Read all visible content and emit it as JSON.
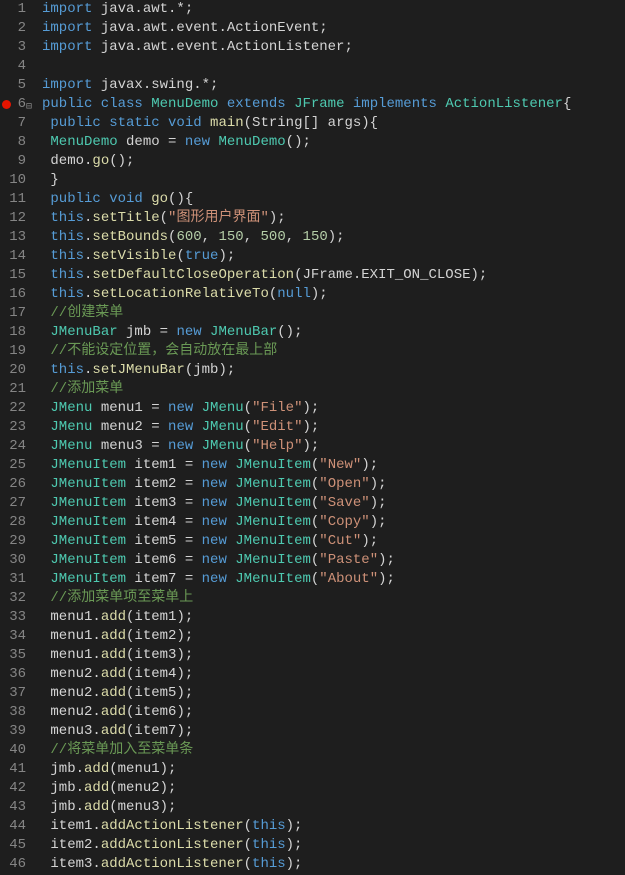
{
  "lines": [
    {
      "num": 1,
      "tokens": [
        [
          "kw",
          "import"
        ],
        [
          "punct",
          " java.awt.*;"
        ]
      ]
    },
    {
      "num": 2,
      "tokens": [
        [
          "kw",
          "import"
        ],
        [
          "punct",
          " java.awt.event.ActionEvent;"
        ]
      ]
    },
    {
      "num": 3,
      "tokens": [
        [
          "kw",
          "import"
        ],
        [
          "punct",
          " java.awt.event.ActionListener;"
        ]
      ]
    },
    {
      "num": 4,
      "tokens": [
        [
          "punct",
          ""
        ]
      ]
    },
    {
      "num": 5,
      "tokens": [
        [
          "kw",
          "import"
        ],
        [
          "punct",
          " javax.swing.*;"
        ]
      ]
    },
    {
      "num": 6,
      "breakpoint": true,
      "fold": true,
      "tokens": [
        [
          "kw",
          "public class "
        ],
        [
          "type",
          "MenuDemo"
        ],
        [
          "kw",
          " extends "
        ],
        [
          "type",
          "JFrame"
        ],
        [
          "kw",
          " implements "
        ],
        [
          "type",
          "ActionListener"
        ],
        [
          "punct",
          "{"
        ]
      ]
    },
    {
      "num": 7,
      "tokens": [
        [
          "punct",
          " "
        ],
        [
          "kw",
          "public static void "
        ],
        [
          "fn",
          "main"
        ],
        [
          "punct",
          "(String[] args){"
        ]
      ]
    },
    {
      "num": 8,
      "tokens": [
        [
          "punct",
          " "
        ],
        [
          "type",
          "MenuDemo"
        ],
        [
          "punct",
          " demo = "
        ],
        [
          "kw",
          "new "
        ],
        [
          "type",
          "MenuDemo"
        ],
        [
          "punct",
          "();"
        ]
      ]
    },
    {
      "num": 9,
      "tokens": [
        [
          "punct",
          " demo."
        ],
        [
          "fn",
          "go"
        ],
        [
          "punct",
          "();"
        ]
      ]
    },
    {
      "num": 10,
      "tokens": [
        [
          "punct",
          " }"
        ]
      ]
    },
    {
      "num": 11,
      "tokens": [
        [
          "punct",
          " "
        ],
        [
          "kw",
          "public void "
        ],
        [
          "fn",
          "go"
        ],
        [
          "punct",
          "(){"
        ]
      ]
    },
    {
      "num": 12,
      "tokens": [
        [
          "punct",
          " "
        ],
        [
          "kw",
          "this"
        ],
        [
          "punct",
          "."
        ],
        [
          "fn",
          "setTitle"
        ],
        [
          "punct",
          "("
        ],
        [
          "str",
          "\"图形用户界面\""
        ],
        [
          "punct",
          ");"
        ]
      ]
    },
    {
      "num": 13,
      "tokens": [
        [
          "punct",
          " "
        ],
        [
          "kw",
          "this"
        ],
        [
          "punct",
          "."
        ],
        [
          "fn",
          "setBounds"
        ],
        [
          "punct",
          "("
        ],
        [
          "num",
          "600"
        ],
        [
          "punct",
          ", "
        ],
        [
          "num",
          "150"
        ],
        [
          "punct",
          ", "
        ],
        [
          "num",
          "500"
        ],
        [
          "punct",
          ", "
        ],
        [
          "num",
          "150"
        ],
        [
          "punct",
          ");"
        ]
      ]
    },
    {
      "num": 14,
      "tokens": [
        [
          "punct",
          " "
        ],
        [
          "kw",
          "this"
        ],
        [
          "punct",
          "."
        ],
        [
          "fn",
          "setVisible"
        ],
        [
          "punct",
          "("
        ],
        [
          "kw",
          "true"
        ],
        [
          "punct",
          ");"
        ]
      ]
    },
    {
      "num": 15,
      "tokens": [
        [
          "punct",
          " "
        ],
        [
          "kw",
          "this"
        ],
        [
          "punct",
          "."
        ],
        [
          "fn",
          "setDefaultCloseOperation"
        ],
        [
          "punct",
          "(JFrame.EXIT_ON_CLOSE);"
        ]
      ]
    },
    {
      "num": 16,
      "tokens": [
        [
          "punct",
          " "
        ],
        [
          "kw",
          "this"
        ],
        [
          "punct",
          "."
        ],
        [
          "fn",
          "setLocationRelativeTo"
        ],
        [
          "punct",
          "("
        ],
        [
          "kw",
          "null"
        ],
        [
          "punct",
          ");"
        ]
      ]
    },
    {
      "num": 17,
      "tokens": [
        [
          "punct",
          " "
        ],
        [
          "cmt",
          "//创建菜单"
        ]
      ]
    },
    {
      "num": 18,
      "tokens": [
        [
          "punct",
          " "
        ],
        [
          "type",
          "JMenuBar"
        ],
        [
          "punct",
          " jmb = "
        ],
        [
          "kw",
          "new "
        ],
        [
          "type",
          "JMenuBar"
        ],
        [
          "punct",
          "();"
        ]
      ]
    },
    {
      "num": 19,
      "tokens": [
        [
          "punct",
          " "
        ],
        [
          "cmt",
          "//不能设定位置，会自动放在最上部"
        ]
      ]
    },
    {
      "num": 20,
      "tokens": [
        [
          "punct",
          " "
        ],
        [
          "kw",
          "this"
        ],
        [
          "punct",
          "."
        ],
        [
          "fn",
          "setJMenuBar"
        ],
        [
          "punct",
          "(jmb);"
        ]
      ]
    },
    {
      "num": 21,
      "tokens": [
        [
          "punct",
          " "
        ],
        [
          "cmt",
          "//添加菜单"
        ]
      ]
    },
    {
      "num": 22,
      "tokens": [
        [
          "punct",
          " "
        ],
        [
          "type",
          "JMenu"
        ],
        [
          "punct",
          " menu1 = "
        ],
        [
          "kw",
          "new "
        ],
        [
          "type",
          "JMenu"
        ],
        [
          "punct",
          "("
        ],
        [
          "str",
          "\"File\""
        ],
        [
          "punct",
          ");"
        ]
      ]
    },
    {
      "num": 23,
      "tokens": [
        [
          "punct",
          " "
        ],
        [
          "type",
          "JMenu"
        ],
        [
          "punct",
          " menu2 = "
        ],
        [
          "kw",
          "new "
        ],
        [
          "type",
          "JMenu"
        ],
        [
          "punct",
          "("
        ],
        [
          "str",
          "\"Edit\""
        ],
        [
          "punct",
          ");"
        ]
      ]
    },
    {
      "num": 24,
      "tokens": [
        [
          "punct",
          " "
        ],
        [
          "type",
          "JMenu"
        ],
        [
          "punct",
          " menu3 = "
        ],
        [
          "kw",
          "new "
        ],
        [
          "type",
          "JMenu"
        ],
        [
          "punct",
          "("
        ],
        [
          "str",
          "\"Help\""
        ],
        [
          "punct",
          ");"
        ]
      ]
    },
    {
      "num": 25,
      "tokens": [
        [
          "punct",
          " "
        ],
        [
          "type",
          "JMenuItem"
        ],
        [
          "punct",
          " item1 = "
        ],
        [
          "kw",
          "new "
        ],
        [
          "type",
          "JMenuItem"
        ],
        [
          "punct",
          "("
        ],
        [
          "str",
          "\"New\""
        ],
        [
          "punct",
          ");"
        ]
      ]
    },
    {
      "num": 26,
      "tokens": [
        [
          "punct",
          " "
        ],
        [
          "type",
          "JMenuItem"
        ],
        [
          "punct",
          " item2 = "
        ],
        [
          "kw",
          "new "
        ],
        [
          "type",
          "JMenuItem"
        ],
        [
          "punct",
          "("
        ],
        [
          "str",
          "\"Open\""
        ],
        [
          "punct",
          ");"
        ]
      ]
    },
    {
      "num": 27,
      "tokens": [
        [
          "punct",
          " "
        ],
        [
          "type",
          "JMenuItem"
        ],
        [
          "punct",
          " item3 = "
        ],
        [
          "kw",
          "new "
        ],
        [
          "type",
          "JMenuItem"
        ],
        [
          "punct",
          "("
        ],
        [
          "str",
          "\"Save\""
        ],
        [
          "punct",
          ");"
        ]
      ]
    },
    {
      "num": 28,
      "tokens": [
        [
          "punct",
          " "
        ],
        [
          "type",
          "JMenuItem"
        ],
        [
          "punct",
          " item4 = "
        ],
        [
          "kw",
          "new "
        ],
        [
          "type",
          "JMenuItem"
        ],
        [
          "punct",
          "("
        ],
        [
          "str",
          "\"Copy\""
        ],
        [
          "punct",
          ");"
        ]
      ]
    },
    {
      "num": 29,
      "tokens": [
        [
          "punct",
          " "
        ],
        [
          "type",
          "JMenuItem"
        ],
        [
          "punct",
          " item5 = "
        ],
        [
          "kw",
          "new "
        ],
        [
          "type",
          "JMenuItem"
        ],
        [
          "punct",
          "("
        ],
        [
          "str",
          "\"Cut\""
        ],
        [
          "punct",
          ");"
        ]
      ]
    },
    {
      "num": 30,
      "tokens": [
        [
          "punct",
          " "
        ],
        [
          "type",
          "JMenuItem"
        ],
        [
          "punct",
          " item6 = "
        ],
        [
          "kw",
          "new "
        ],
        [
          "type",
          "JMenuItem"
        ],
        [
          "punct",
          "("
        ],
        [
          "str",
          "\"Paste\""
        ],
        [
          "punct",
          ");"
        ]
      ]
    },
    {
      "num": 31,
      "tokens": [
        [
          "punct",
          " "
        ],
        [
          "type",
          "JMenuItem"
        ],
        [
          "punct",
          " item7 = "
        ],
        [
          "kw",
          "new "
        ],
        [
          "type",
          "JMenuItem"
        ],
        [
          "punct",
          "("
        ],
        [
          "str",
          "\"About\""
        ],
        [
          "punct",
          ");"
        ]
      ]
    },
    {
      "num": 32,
      "tokens": [
        [
          "punct",
          " "
        ],
        [
          "cmt",
          "//添加菜单项至菜单上"
        ]
      ]
    },
    {
      "num": 33,
      "tokens": [
        [
          "punct",
          " menu1."
        ],
        [
          "fn",
          "add"
        ],
        [
          "punct",
          "(item1);"
        ]
      ]
    },
    {
      "num": 34,
      "tokens": [
        [
          "punct",
          " menu1."
        ],
        [
          "fn",
          "add"
        ],
        [
          "punct",
          "(item2);"
        ]
      ]
    },
    {
      "num": 35,
      "tokens": [
        [
          "punct",
          " menu1."
        ],
        [
          "fn",
          "add"
        ],
        [
          "punct",
          "(item3);"
        ]
      ]
    },
    {
      "num": 36,
      "tokens": [
        [
          "punct",
          " menu2."
        ],
        [
          "fn",
          "add"
        ],
        [
          "punct",
          "(item4);"
        ]
      ]
    },
    {
      "num": 37,
      "tokens": [
        [
          "punct",
          " menu2."
        ],
        [
          "fn",
          "add"
        ],
        [
          "punct",
          "(item5);"
        ]
      ]
    },
    {
      "num": 38,
      "tokens": [
        [
          "punct",
          " menu2."
        ],
        [
          "fn",
          "add"
        ],
        [
          "punct",
          "(item6);"
        ]
      ]
    },
    {
      "num": 39,
      "tokens": [
        [
          "punct",
          " menu3."
        ],
        [
          "fn",
          "add"
        ],
        [
          "punct",
          "(item7);"
        ]
      ]
    },
    {
      "num": 40,
      "tokens": [
        [
          "punct",
          " "
        ],
        [
          "cmt",
          "//将菜单加入至菜单条"
        ]
      ]
    },
    {
      "num": 41,
      "tokens": [
        [
          "punct",
          " jmb."
        ],
        [
          "fn",
          "add"
        ],
        [
          "punct",
          "(menu1);"
        ]
      ]
    },
    {
      "num": 42,
      "tokens": [
        [
          "punct",
          " jmb."
        ],
        [
          "fn",
          "add"
        ],
        [
          "punct",
          "(menu2);"
        ]
      ]
    },
    {
      "num": 43,
      "tokens": [
        [
          "punct",
          " jmb."
        ],
        [
          "fn",
          "add"
        ],
        [
          "punct",
          "(menu3);"
        ]
      ]
    },
    {
      "num": 44,
      "tokens": [
        [
          "punct",
          " item1."
        ],
        [
          "fn",
          "addActionListener"
        ],
        [
          "punct",
          "("
        ],
        [
          "kw",
          "this"
        ],
        [
          "punct",
          ");"
        ]
      ]
    },
    {
      "num": 45,
      "tokens": [
        [
          "punct",
          " item2."
        ],
        [
          "fn",
          "addActionListener"
        ],
        [
          "punct",
          "("
        ],
        [
          "kw",
          "this"
        ],
        [
          "punct",
          ");"
        ]
      ]
    },
    {
      "num": 46,
      "tokens": [
        [
          "punct",
          " item3."
        ],
        [
          "fn",
          "addActionListener"
        ],
        [
          "punct",
          "("
        ],
        [
          "kw",
          "this"
        ],
        [
          "punct",
          ");"
        ]
      ]
    }
  ]
}
